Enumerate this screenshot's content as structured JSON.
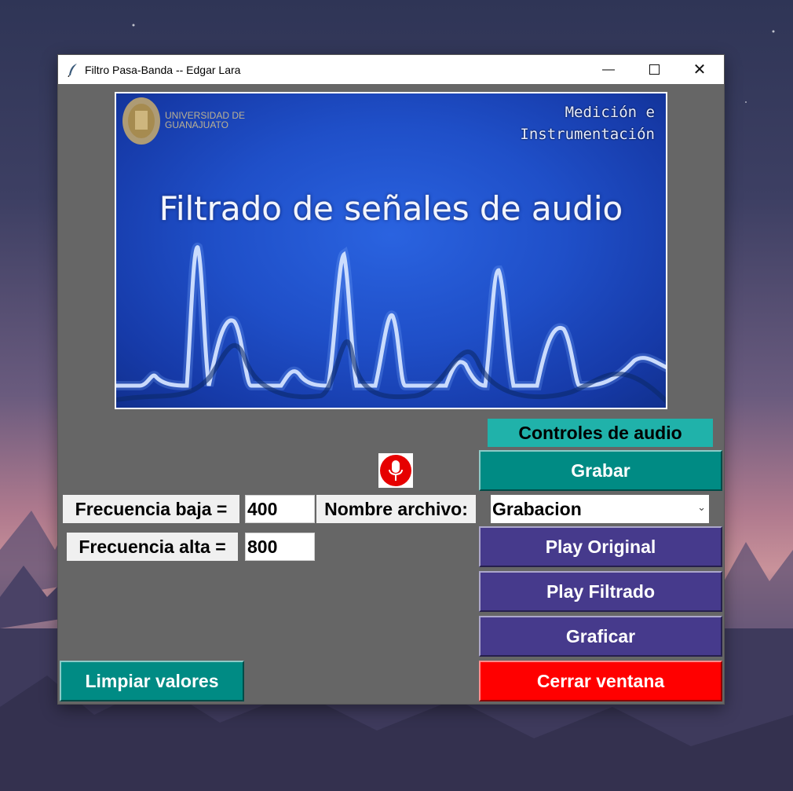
{
  "window": {
    "title": "Filtro Pasa-Banda -- Edgar Lara",
    "icons": {
      "app": "feather-icon",
      "minimize": "minimize-icon",
      "maximize": "maximize-icon",
      "close": "close-icon"
    }
  },
  "banner": {
    "university": [
      "UNIVERSIDAD DE",
      "GUANAJUATO"
    ],
    "course": [
      "Medición e",
      "Instrumentación"
    ],
    "title": "Filtrado de señales de audio"
  },
  "controls": {
    "header": "Controles de audio",
    "record_label": "Grabar",
    "play_original_label": "Play Original",
    "play_filtered_label": "Play Filtrado",
    "plot_label": "Graficar",
    "close_label": "Cerrar ventana",
    "clear_label": "Limpiar valores",
    "mic_icon": "microphone-icon"
  },
  "form": {
    "low_label": "Frecuencia baja =",
    "low_value": "400",
    "high_label": "Frecuencia alta =",
    "high_value": "800",
    "filename_label": "Nombre archivo:",
    "filename_value": "Grabacion"
  },
  "colors": {
    "window_bg": "#666666",
    "teal": "#008b84",
    "header_teal": "#20b2aa",
    "purple": "#463a8c",
    "red": "#ff0000"
  }
}
